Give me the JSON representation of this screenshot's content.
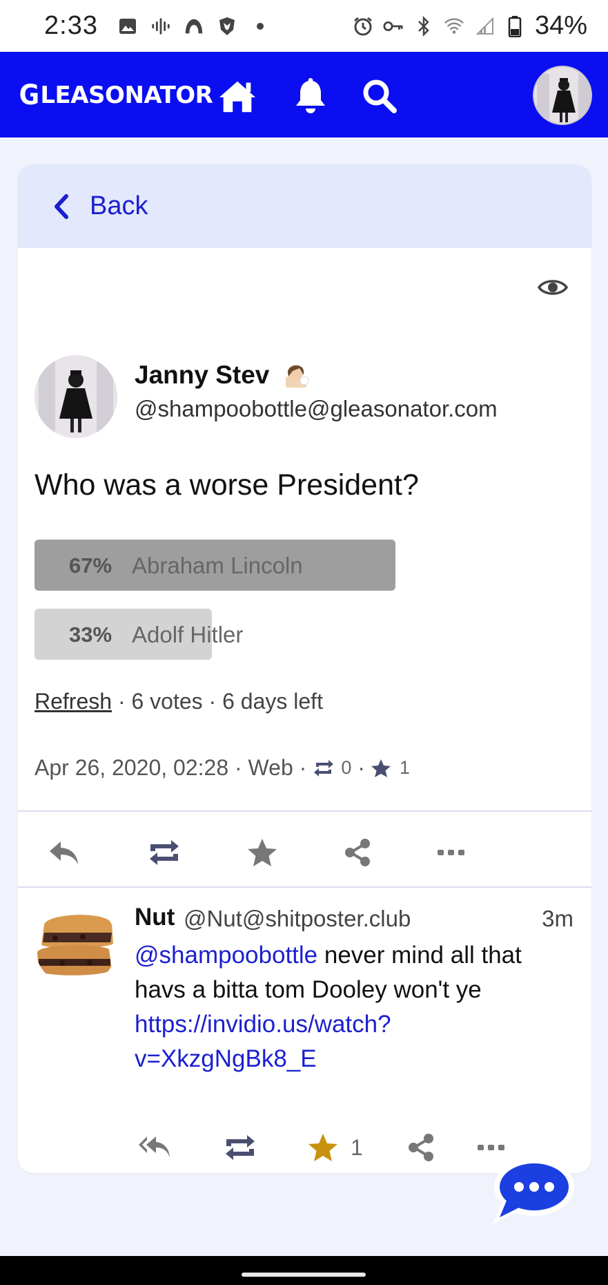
{
  "status_bar": {
    "time": "2:33",
    "battery": "34%"
  },
  "app": {
    "logo_first": "G",
    "logo_rest": "LEASONATOR",
    "accent_color": "#0a0ef0"
  },
  "back": {
    "label": "Back"
  },
  "post": {
    "author_name": "Janny Stev",
    "author_handle": "@shampoobottle@gleasonator.com",
    "text": "Who was a worse President?",
    "poll": {
      "options": [
        {
          "percent": "67%",
          "label": "Abraham Lincoln",
          "fraction": 0.67
        },
        {
          "percent": "33%",
          "label": "Adolf Hitler",
          "fraction": 0.33
        }
      ],
      "refresh_label": "Refresh",
      "meta": " · 6 votes · 6 days left"
    },
    "date": "Apr 26, 2020, 02:28",
    "client": "Web",
    "reblogs": "0",
    "favourites": "1"
  },
  "reply": {
    "name": "Nut",
    "handle": "@Nut@shitposter.club",
    "time": "3m",
    "mention": "@shampoobottle",
    "text": " never mind all that havs a bitta tom Dooley won't ye",
    "link_line1": "https://invidio.us/watch?",
    "link_line2": "v=XkzgNgBk8_E",
    "favourites": "1",
    "favourite_color": "#c8920e"
  }
}
